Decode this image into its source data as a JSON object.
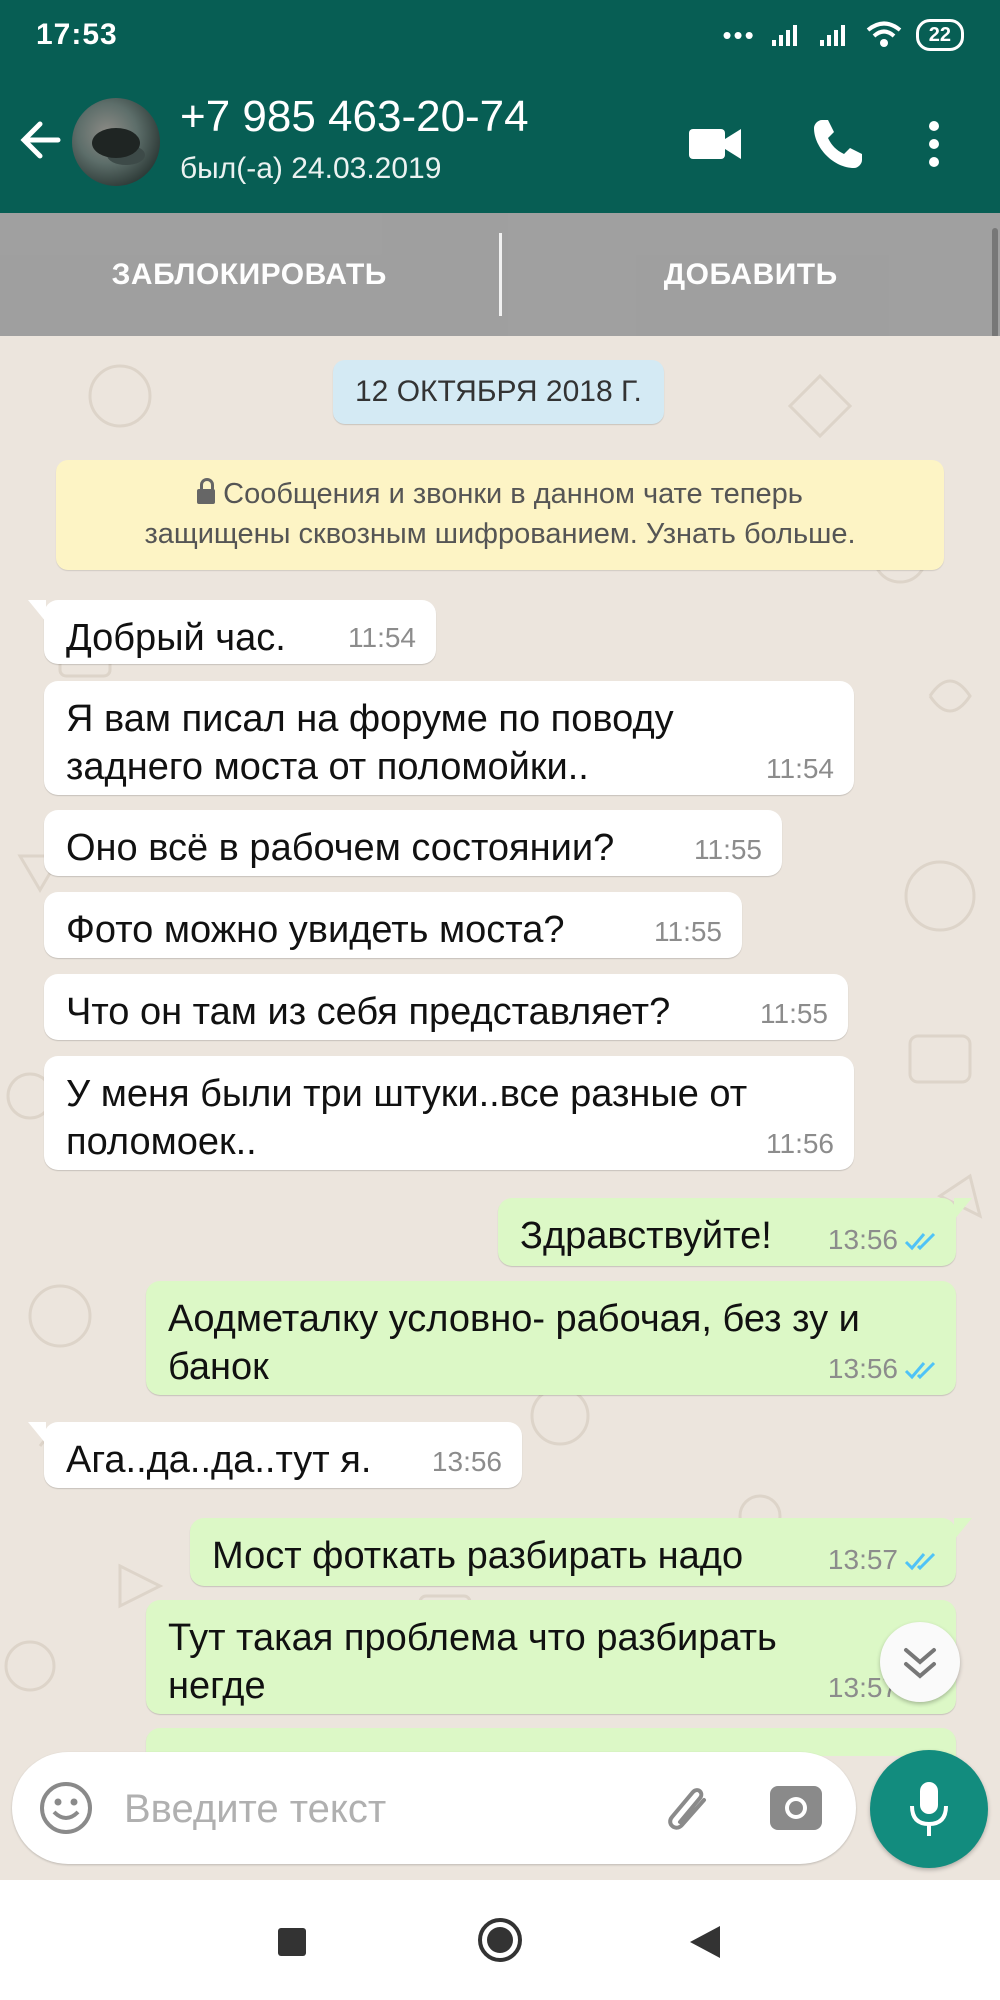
{
  "status_bar": {
    "time": "17:53",
    "battery": "22"
  },
  "header": {
    "contact_name": "+7 985 463-20-74",
    "last_seen": "был(-а) 24.03.2019"
  },
  "unknown_contact_bar": {
    "block_label": "ЗАБЛОКИРОВАТЬ",
    "add_label": "ДОБАВИТЬ"
  },
  "chat": {
    "date_label": "12 ОКТЯБРЯ 2018 Г.",
    "encryption_notice": {
      "line1": "Сообщения и звонки в данном чате теперь",
      "line2": "защищены сквозным шифрованием. Узнать больше."
    },
    "messages": [
      {
        "direction": "in",
        "lines": [
          "Добрый час."
        ],
        "time": "11:54"
      },
      {
        "direction": "in",
        "lines": [
          "Я вам писал на форуме по поводу",
          "заднего моста от поломойки.."
        ],
        "time": "11:54"
      },
      {
        "direction": "in",
        "lines": [
          "Оно всё в рабочем состоянии?"
        ],
        "time": "11:55"
      },
      {
        "direction": "in",
        "lines": [
          "Фото можно увидеть моста?"
        ],
        "time": "11:55"
      },
      {
        "direction": "in",
        "lines": [
          "Что он там из себя представляет?"
        ],
        "time": "11:55"
      },
      {
        "direction": "in",
        "lines": [
          "У меня были три штуки..все разные от",
          "поломоек.."
        ],
        "time": "11:56"
      },
      {
        "direction": "out",
        "lines": [
          "Здравствуйте!"
        ],
        "time": "13:56",
        "status": "read"
      },
      {
        "direction": "out",
        "lines": [
          "Аодметалку условно- рабочая, без зу и",
          "банок"
        ],
        "time": "13:56",
        "status": "read"
      },
      {
        "direction": "in",
        "lines": [
          "Ага..да..да..тут я."
        ],
        "time": "13:56"
      },
      {
        "direction": "out",
        "lines": [
          "Мост фоткать разбирать надо"
        ],
        "time": "13:57",
        "status": "read"
      },
      {
        "direction": "out",
        "lines": [
          "Тут такая проблема что разбирать",
          "негде"
        ],
        "time": "13:57",
        "status": "read"
      }
    ]
  },
  "composer": {
    "placeholder": "Введите текст"
  },
  "icons": {
    "back": "arrow-left-icon",
    "video": "video-call-icon",
    "call": "phone-icon",
    "menu": "more-vert-icon",
    "emoji": "emoji-icon",
    "attach": "paperclip-icon",
    "camera": "camera-icon",
    "mic": "mic-icon",
    "scroll_down": "chevron-double-down-icon"
  },
  "colors": {
    "header": "#075e54",
    "incoming_bubble": "#ffffff",
    "outgoing_bubble": "#dcf8c6",
    "read_ticks": "#4fc3f7",
    "mic_button": "#128c7e",
    "chat_bg": "#ece5dd"
  }
}
